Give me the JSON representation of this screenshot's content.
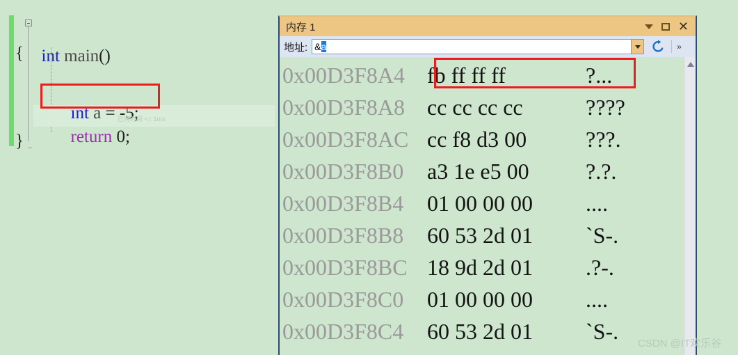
{
  "editor": {
    "lines": [
      {
        "segments": [
          {
            "text": "int ",
            "cls": "kw-blue"
          },
          {
            "text": "main",
            "cls": "fn-name"
          },
          {
            "text": "()",
            "cls": "plain"
          }
        ]
      },
      {
        "segments": [
          {
            "text": "{",
            "cls": "plain"
          }
        ]
      },
      {
        "segments": [
          {
            "text": "int ",
            "cls": "kw-blue"
          },
          {
            "text": "a",
            "cls": "id-dark"
          },
          {
            "text": " = ",
            "cls": "plain"
          },
          {
            "text": "-5;",
            "cls": "plain"
          }
        ]
      },
      {
        "segments": [
          {
            "text": "return ",
            "cls": "kw-purple"
          },
          {
            "text": "0;",
            "cls": "plain"
          }
        ]
      },
      {
        "segments": [
          {
            "text": "}",
            "cls": "plain"
          }
        ]
      }
    ],
    "line1": "int main()",
    "line2": "{",
    "line3": "int a = -5;",
    "line4": "return 0;",
    "line5": "}",
    "elapsed_annotation": "已用时间 <= 1ms",
    "highlight_color": "#ef1c1c",
    "background_color": "#cde6cd",
    "change_bar_color": "#6fdb6f"
  },
  "memory_window": {
    "title": "内存 1",
    "title_bar_color": "#eec683",
    "title_buttons": {
      "dropdown": "▼",
      "maximize": "□",
      "close": "✕"
    },
    "toolbar": {
      "address_label": "地址:",
      "address_value_prefix": "&",
      "address_value_selected": "a",
      "address_full_value": "&a",
      "address_placeholder": "地址",
      "refresh_label": "刷新",
      "overflow_label": "»"
    },
    "columns": [
      "address",
      "hex",
      "ascii"
    ],
    "rows": [
      {
        "address": "0x00D3F8A4",
        "hex": "fb ff ff ff",
        "ascii": "?..."
      },
      {
        "address": "0x00D3F8A8",
        "hex": "cc cc cc cc",
        "ascii": "????"
      },
      {
        "address": "0x00D3F8AC",
        "hex": "cc f8 d3 00",
        "ascii": "???."
      },
      {
        "address": "0x00D3F8B0",
        "hex": "a3 1e e5 00",
        "ascii": "?.?."
      },
      {
        "address": "0x00D3F8B4",
        "hex": "01 00 00 00",
        "ascii": "...."
      },
      {
        "address": "0x00D3F8B8",
        "hex": "60 53 2d 01",
        "ascii": "`S-."
      },
      {
        "address": "0x00D3F8BC",
        "hex": "18 9d 2d 01",
        "ascii": ".?-."
      },
      {
        "address": "0x00D3F8C0",
        "hex": "01 00 00 00",
        "ascii": "...."
      },
      {
        "address": "0x00D3F8C4",
        "hex": "60 53 2d 01",
        "ascii": "`S-."
      }
    ],
    "highlighted_row_index": 0,
    "highlight_color": "#ef1c1c"
  },
  "watermark": "CSDN @IT欢乐谷"
}
